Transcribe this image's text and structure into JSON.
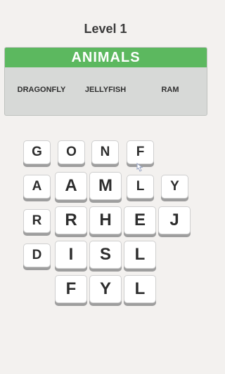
{
  "header": {
    "level_label": "Level 1"
  },
  "category": {
    "name": "ANIMALS",
    "header_color": "#5cb85f",
    "words": [
      "DRAGONFLY",
      "JELLYFISH",
      "RAM"
    ]
  },
  "grid": {
    "tiles": [
      "G",
      "O",
      "N",
      "F",
      "A",
      "A",
      "M",
      "L",
      "Y",
      "R",
      "R",
      "H",
      "E",
      "J",
      "D",
      "I",
      "S",
      "L",
      "F",
      "Y",
      "L"
    ]
  },
  "icons": {
    "hint_pointer": "hand-pointer-icon"
  }
}
